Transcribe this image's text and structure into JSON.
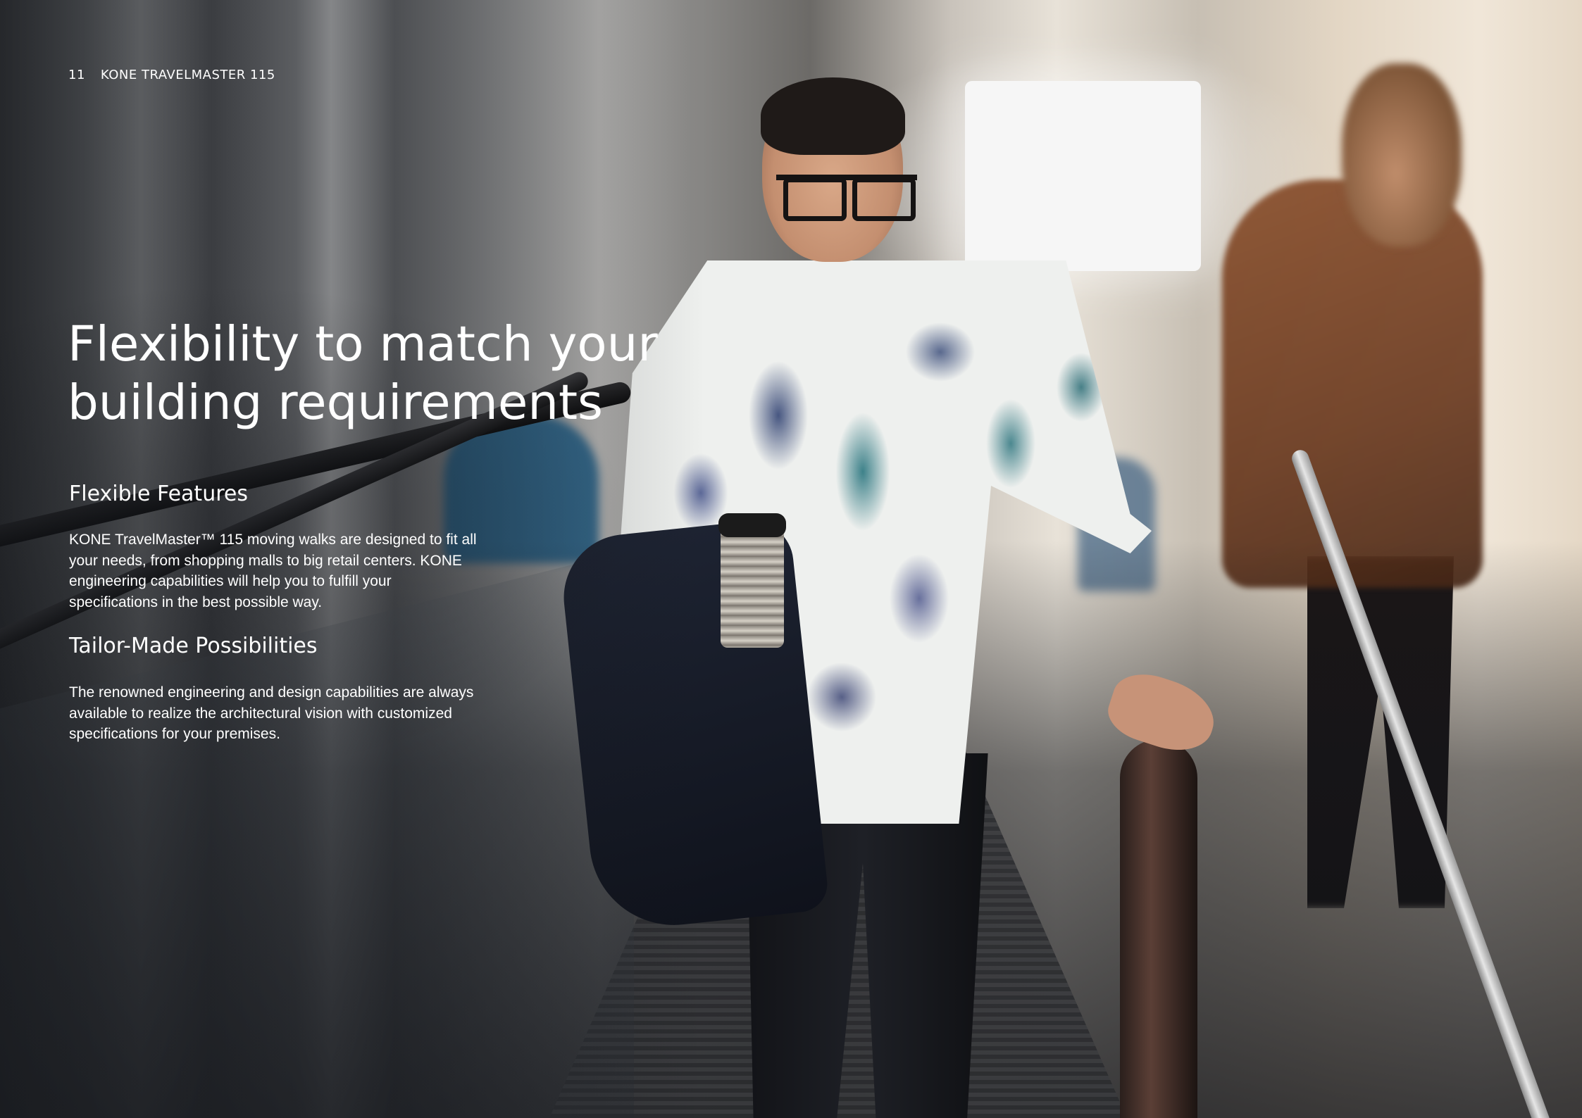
{
  "header": {
    "page_number": "11",
    "product": "KONE TRAVELMASTER 115"
  },
  "title": "Flexibility to match your\nbuilding requirements",
  "sections": [
    {
      "heading": "Flexible Features",
      "body": "KONE TravelMaster™ 115 moving walks are designed to fit all your needs, from shopping malls to big retail centers. KONE engineering capabilities will help you to fulfill your specifications in the best possible way."
    },
    {
      "heading": "Tailor-Made Possibilities",
      "body": "The renowned engineering and design capabilities are always available to realize the architectural vision with customized specifications for your premises."
    }
  ],
  "background_image": "man with glasses and patterned shirt holding a travel cup and jacket, riding a moving walkway in a bright terminal; other passengers in background"
}
